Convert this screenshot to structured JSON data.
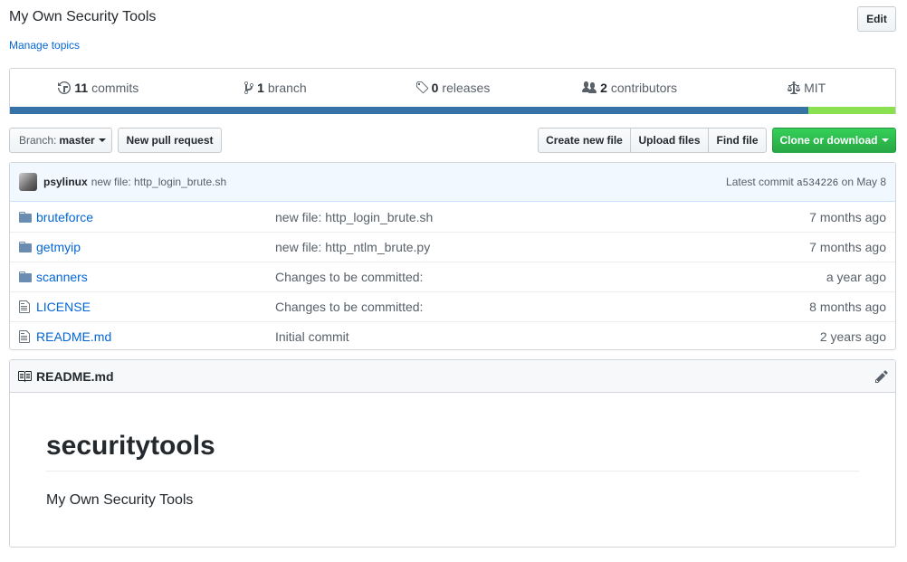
{
  "repo": {
    "description": "My Own Security Tools",
    "manage_topics": "Manage topics",
    "edit_label": "Edit"
  },
  "summary": {
    "commits_num": "11",
    "commits_label": "commits",
    "branch_num": "1",
    "branch_label": "branch",
    "releases_num": "0",
    "releases_label": "releases",
    "contributors_num": "2",
    "contributors_label": "contributors",
    "license": "MIT"
  },
  "language_bar": [
    {
      "color": "#3572A5",
      "fraction": 0.902
    },
    {
      "color": "#89e051",
      "fraction": 0.098
    }
  ],
  "toolbar": {
    "branch_prefix": "Branch:",
    "branch_name": "master",
    "new_pr": "New pull request",
    "create_file": "Create new file",
    "upload_files": "Upload files",
    "find_file": "Find file",
    "clone": "Clone or download"
  },
  "latest_commit": {
    "author": "psylinux",
    "message": "new file: http_login_brute.sh",
    "prefix": "Latest commit",
    "sha": "a534226",
    "date": "on May 8"
  },
  "files": [
    {
      "type": "folder",
      "name": "bruteforce",
      "message": "new file: http_login_brute.sh",
      "age": "7 months ago"
    },
    {
      "type": "folder",
      "name": "getmyip",
      "message": "new file: http_ntlm_brute.py",
      "age": "7 months ago"
    },
    {
      "type": "folder",
      "name": "scanners",
      "message": "Changes to be committed:",
      "age": "a year ago"
    },
    {
      "type": "file",
      "name": "LICENSE",
      "message": "Changes to be committed:",
      "age": "8 months ago"
    },
    {
      "type": "file",
      "name": "README.md",
      "message": "Initial commit",
      "age": "2 years ago"
    }
  ],
  "readme": {
    "filename": "README.md",
    "heading": "securitytools",
    "body": "My Own Security Tools"
  },
  "icons": [
    "history-icon",
    "branch-icon",
    "tag-icon",
    "people-icon",
    "law-icon",
    "folder-icon",
    "file-icon",
    "book-icon",
    "pencil-icon"
  ]
}
